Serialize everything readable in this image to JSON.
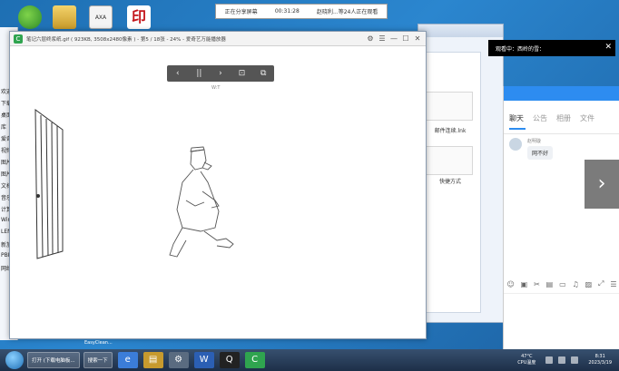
{
  "share_bar": {
    "status": "正在分享屏幕",
    "timer": "00:31:28",
    "viewers": "赵晓利...等24人正在观看"
  },
  "desktop_icons": {
    "c_label": "AXA",
    "d_label": "印"
  },
  "viewer": {
    "logo_glyph": "C",
    "title": "笔记六层终浆纸.gif ( 923KB, 3508x2480像素 ) - 第5 / 18张 - 24% - 爱奇艺万能播放器",
    "toolbar": {
      "prev": "‹",
      "pause": "||",
      "next": "›",
      "fit": "⊡",
      "full": "⧉"
    },
    "zoom_label": "W:T",
    "title_buttons": [
      "⚙",
      "☰",
      "—",
      "☐",
      "✕"
    ]
  },
  "left_window": {
    "items": [
      "欢迎",
      "下载",
      "桌面",
      "库",
      "爱奇",
      "视频",
      "图片",
      "图片",
      "文档",
      "音乐",
      "计算机",
      "Win",
      "LENO",
      "新加",
      "PBR",
      "网络"
    ]
  },
  "bg_window": {
    "files": [
      "新建Mi...bmp",
      "邮件连续.lnk",
      "快捷方式"
    ]
  },
  "watch_banner": {
    "text": "观看中：西岭的雪：",
    "close": "✕"
  },
  "chat": {
    "tabs": [
      "聊天",
      "公告",
      "相册",
      "文件"
    ],
    "sender": "赵明璇",
    "message": "网不好",
    "tools": [
      "☺",
      "▣",
      "✂",
      "▤",
      "▭",
      "♫",
      "▨",
      "⤢",
      "☰"
    ]
  },
  "next_arrow": "›",
  "taskbar": {
    "btn_folder": "打开 (下载电脑板...",
    "btn_search": "搜索一下",
    "label_overlay": "EasyClean...",
    "temp": "47°C",
    "temp_label": "CPU温度",
    "clock_time": "8:31",
    "clock_date": "2023/3/19",
    "icons": [
      "e",
      "▤",
      "⚙",
      "W",
      "Q",
      "C"
    ]
  },
  "colors": {
    "accent": "#2d8cf0",
    "desktop": "#1e6fb3",
    "taskbar": "#1d2f48"
  }
}
